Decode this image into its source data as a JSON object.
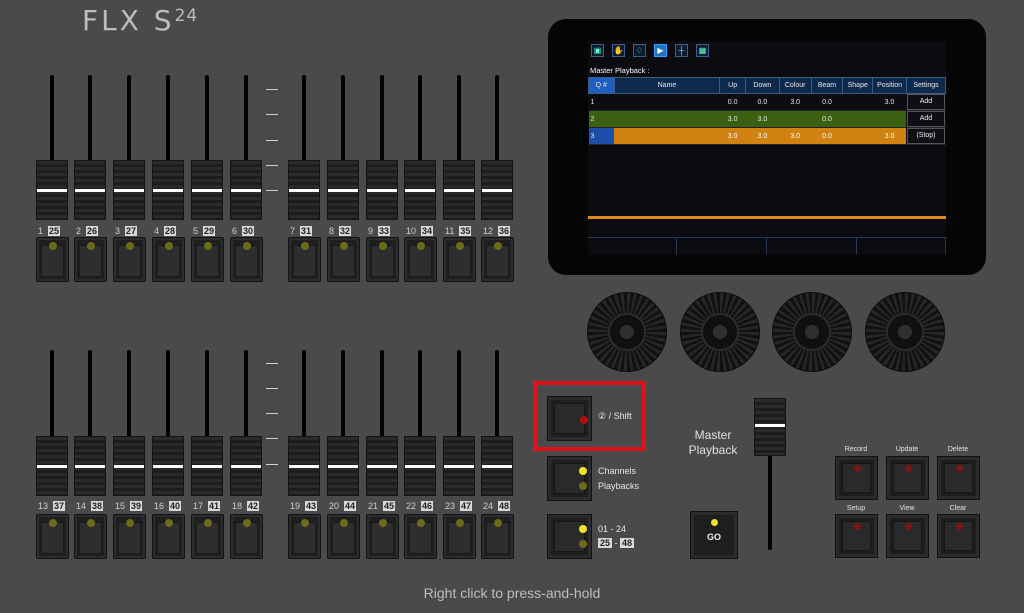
{
  "logo": {
    "text": "FLX S",
    "superscript": "24"
  },
  "top_faders": [
    {
      "num": "1",
      "alt": "25"
    },
    {
      "num": "2",
      "alt": "26"
    },
    {
      "num": "3",
      "alt": "27"
    },
    {
      "num": "4",
      "alt": "28"
    },
    {
      "num": "5",
      "alt": "29"
    },
    {
      "num": "6",
      "alt": "30"
    },
    {
      "num": "7",
      "alt": "31"
    },
    {
      "num": "8",
      "alt": "32"
    },
    {
      "num": "9",
      "alt": "33"
    },
    {
      "num": "10",
      "alt": "34"
    },
    {
      "num": "11",
      "alt": "35"
    },
    {
      "num": "12",
      "alt": "36"
    }
  ],
  "bottom_faders": [
    {
      "num": "13",
      "alt": "37"
    },
    {
      "num": "14",
      "alt": "38"
    },
    {
      "num": "15",
      "alt": "39"
    },
    {
      "num": "16",
      "alt": "40"
    },
    {
      "num": "17",
      "alt": "41"
    },
    {
      "num": "18",
      "alt": "42"
    },
    {
      "num": "19",
      "alt": "43"
    },
    {
      "num": "20",
      "alt": "44"
    },
    {
      "num": "21",
      "alt": "45"
    },
    {
      "num": "22",
      "alt": "46"
    },
    {
      "num": "23",
      "alt": "47"
    },
    {
      "num": "24",
      "alt": "48"
    }
  ],
  "screen": {
    "toolbar_icons": [
      "save-icon",
      "palette-icon",
      "bulb-icon",
      "play-pause-icon",
      "sliders-icon",
      "grid-icon"
    ],
    "active_icon_index": 3,
    "title": "Master Playback :",
    "columns": [
      "Q #",
      "Name",
      "Up",
      "Down",
      "Colour",
      "Beam",
      "Shape",
      "Position",
      "Settings"
    ],
    "rows": [
      {
        "q": "1",
        "name": "",
        "up": "0.0",
        "down": "0.0",
        "colour": "3.0",
        "beam": "0.0",
        "shape": "",
        "position": "3.0",
        "settings": "Add"
      },
      {
        "q": "2",
        "name": "",
        "up": "3.0",
        "down": "3.0",
        "colour": "",
        "beam": "0.0",
        "shape": "",
        "position": "",
        "settings": "Add"
      },
      {
        "q": "3",
        "name": "",
        "up": "3.0",
        "down": "3.0",
        "colour": "3.0",
        "beam": "0.0",
        "shape": "",
        "position": "3.0",
        "settings": "(Stop)"
      }
    ],
    "row_colors": {
      "row2": "#3b6011",
      "row3": "#d08213",
      "row3_q": "#1a4ea8"
    }
  },
  "mode_buttons": {
    "shift": {
      "symbol": "②",
      "label": "/ Shift",
      "led_color": "#b01010"
    },
    "channels_playbacks": {
      "line1": "Channels",
      "line2": "Playbacks",
      "led1_color": "#f2e22a",
      "led2_color": "#6b6b18"
    },
    "pages": {
      "line1": "01 - 24",
      "line2a": "25",
      "line2b": "48",
      "led1_color": "#f2e22a",
      "led2_color": "#6b6b18"
    }
  },
  "master": {
    "line1": "Master",
    "line2": "Playback",
    "go_label": "GO",
    "go_led_color": "#f2e22a"
  },
  "function_buttons": [
    {
      "label": "Record"
    },
    {
      "label": "Update"
    },
    {
      "label": "Delete"
    },
    {
      "label": "Setup"
    },
    {
      "label": "View"
    },
    {
      "label": "Clear"
    }
  ],
  "footer": "Right click to press-and-hold",
  "colors": {
    "background": "#4a4a4a",
    "highlight": "#e0101d",
    "led_on": "#f2e22a"
  }
}
